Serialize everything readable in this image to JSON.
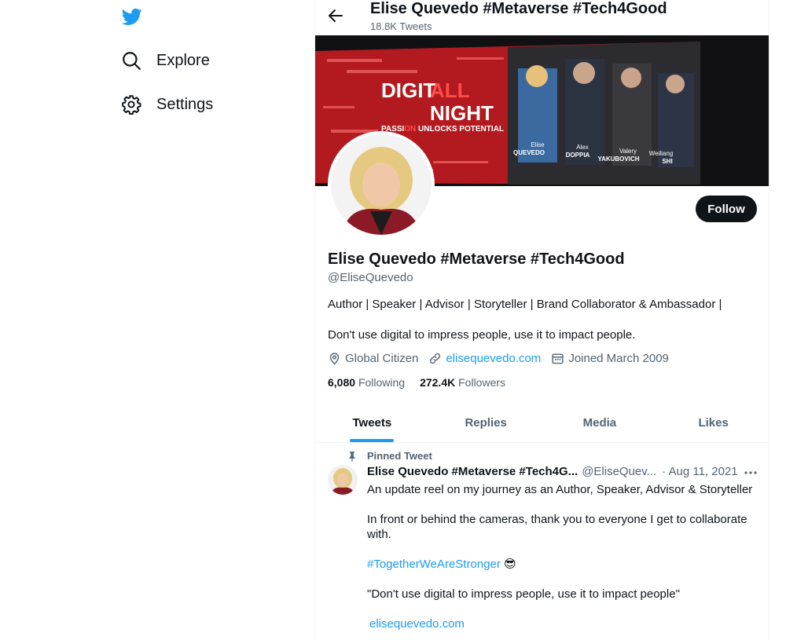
{
  "nav": {
    "logo_icon": "twitter-bird-icon",
    "items": [
      {
        "label": "Explore",
        "icon": "search-icon"
      },
      {
        "label": "Settings",
        "icon": "gear-icon"
      }
    ]
  },
  "header": {
    "title": "Elise Quevedo #Metaverse #Tech4Good",
    "tweet_count": "18.8K Tweets"
  },
  "banner": {
    "headline_part1": "DIGIT",
    "headline_part2": "ALL",
    "headline_line2": "NIGHT",
    "tagline_a": "PASSI",
    "tagline_b": "ON",
    "tagline_c": " UNLOCKS POTENTIAL",
    "speakers": [
      {
        "first": "Elise",
        "last": "QUEVEDO"
      },
      {
        "first": "Alex",
        "last": "DOPPIA"
      },
      {
        "first": "Valery",
        "last": "YAKUBOVICH"
      },
      {
        "first": "Weiliang",
        "last": "SHI"
      }
    ]
  },
  "profile": {
    "follow_label": "Follow",
    "name": "Elise Quevedo #Metaverse #Tech4Good",
    "handle": "@EliseQuevedo",
    "bio_line1": "Author | Speaker | Advisor | Storyteller | Brand Collaborator & Ambassador |",
    "bio_line2": "Don't use digital to impress people, use it to impact people.",
    "location": "Global Citizen",
    "website": "elisequevedo.com",
    "joined": "Joined March 2009",
    "following_count": "6,080",
    "following_label": "Following",
    "followers_count": "272.4K",
    "followers_label": "Followers"
  },
  "tabs": [
    {
      "label": "Tweets",
      "active": true
    },
    {
      "label": "Replies",
      "active": false
    },
    {
      "label": "Media",
      "active": false
    },
    {
      "label": "Likes",
      "active": false
    }
  ],
  "pinned_tweet": {
    "pinned_label": "Pinned Tweet",
    "author_name": "Elise Quevedo #Metaverse #Tech4G...",
    "author_handle": "@EliseQuev...",
    "date": "· Aug 11, 2021",
    "line1": "An update reel on my journey as an Author, Speaker, Advisor & Storyteller",
    "line2": "In front or behind the cameras, thank you to everyone I get to collaborate with.",
    "hashtag": "#TogetherWeAreStronger",
    "emoji": "😎",
    "quote": "\"Don't use digital to impress people, use it to impact people\"",
    "link": "elisequevedo.com"
  },
  "colors": {
    "accent": "#1d9bf0",
    "text": "#0f1419",
    "muted": "#536471",
    "banner_red": "#d7262c"
  }
}
